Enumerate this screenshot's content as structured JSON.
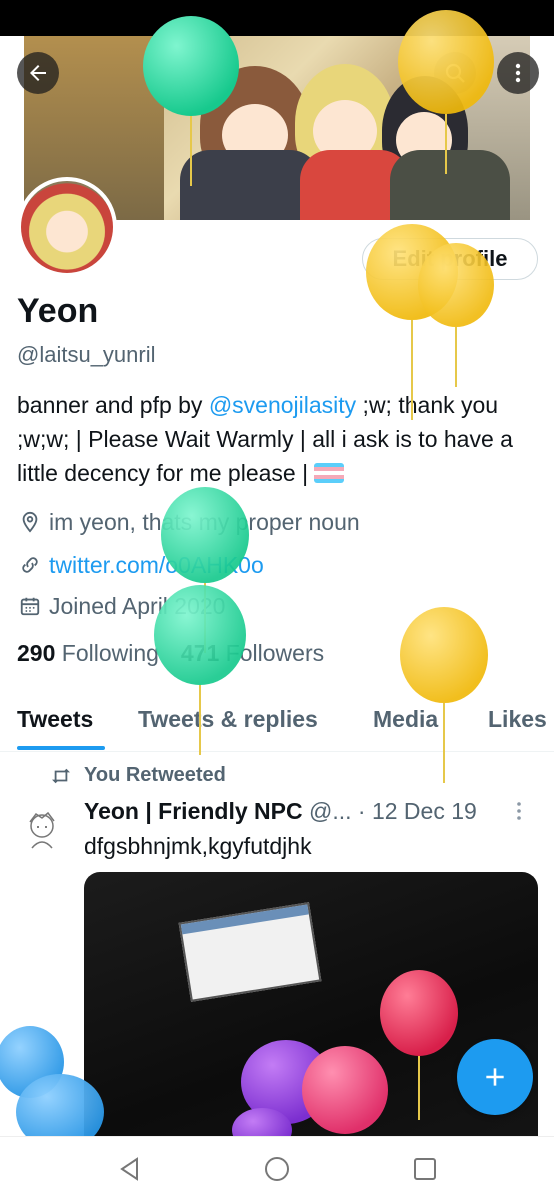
{
  "profile": {
    "display_name": "Yeon",
    "handle": "@laitsu_yunril",
    "edit_button": "Edit profile",
    "bio_before": "banner and pfp by ",
    "bio_mention": "@svenojilasity",
    "bio_after": " ;w; thank you ;w;w; | Please Wait Warmly | all i ask is to have a little decency for me please | ",
    "location": "im yeon, thats my proper noun",
    "website": "twitter.com/o0AHK0o",
    "joined": "Joined April 2020",
    "following_count": "290",
    "following_label": " Following",
    "followers_count": "471",
    "followers_label": " Followers"
  },
  "tabs": [
    "Tweets",
    "Tweets & replies",
    "Media",
    "Likes"
  ],
  "tweet": {
    "retweet_label": "You Retweeted",
    "author_name": "Yeon | Friendly NPC",
    "author_handle": "@...",
    "date": "· 12 Dec 19",
    "text": "dfgsbhnjmk,kgyfutdjhk"
  },
  "icons": {
    "back": "arrow-left-icon",
    "search": "search-icon",
    "more": "more-vertical-icon",
    "location": "location-pin-icon",
    "link": "link-icon",
    "calendar": "calendar-icon",
    "retweet": "retweet-icon",
    "compose": "plus-icon"
  },
  "colors": {
    "accent": "#1d9bf0",
    "secondary_text": "#536471",
    "balloon_green": "#27e0a3",
    "balloon_yellow": "#f5c518",
    "balloon_red": "#e8335a",
    "balloon_purple": "#8b3fd9",
    "balloon_blue": "#3aa9f0"
  }
}
